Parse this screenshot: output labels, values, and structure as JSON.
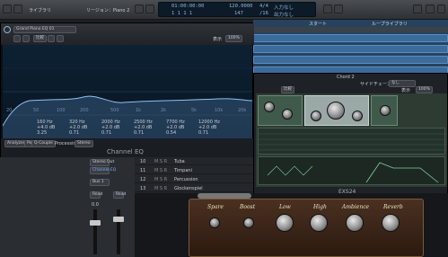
{
  "topbar": {
    "library": "ライブラリ",
    "region": "リージョン：Piano 2",
    "lcd_time": "01:00:00:00",
    "lcd_bars": "1  1  1  1",
    "tempo": "120.0000",
    "tempo_alt": "147",
    "sig": "4/4",
    "sig_alt": "/16",
    "input_none": "入力なし",
    "output_none": "出力なし"
  },
  "right_header": {
    "start": "スタート",
    "loops": "ループライブラリ"
  },
  "eq": {
    "title": "Channel EQ",
    "preset": "Grand Piano EQ 01",
    "compare": "比較",
    "view_label": "表示",
    "view_value": "100%",
    "freq_labels": [
      "20",
      "50",
      "100",
      "200",
      "500",
      "1k",
      "2k",
      "5k",
      "10k",
      "20k"
    ],
    "bands": [
      {
        "freq": "160 Hz",
        "gain": "+4.0 dB",
        "q": "3.25"
      },
      {
        "freq": "320 Hz",
        "gain": "+2.0 dB",
        "q": "0.71"
      },
      {
        "freq": "2000 Hz",
        "gain": "+2.0 dB",
        "q": "0.71"
      },
      {
        "freq": "2500 Hz",
        "gain": "+2.0 dB",
        "q": "0.71"
      },
      {
        "freq": "7700 Hz",
        "gain": "+2.0 dB",
        "q": "0.54"
      },
      {
        "freq": "12000 Hz",
        "gain": "+2.0 dB",
        "q": "0.71"
      }
    ],
    "analyzer": "Analyzer",
    "post": "Post",
    "qcouple": "Q-Couple",
    "processing": "Processing:",
    "processing_value": "Stereo"
  },
  "exs": {
    "title": "EXS24",
    "channel": "Chord 2",
    "sidechain": "サイドチェーン",
    "none": "なし",
    "compare": "比較",
    "view_label": "表示",
    "view_value": "100%"
  },
  "tracks": [
    {
      "num": "10",
      "name": "Tuba"
    },
    {
      "num": "11",
      "name": "Timpani"
    },
    {
      "num": "12",
      "name": "Percussion"
    },
    {
      "num": "13",
      "name": "Glockenspiel"
    }
  ],
  "mixer": {
    "stereo_out": "Stereo Out",
    "channel_eq": "Channel EQ",
    "send": "Bus 1",
    "read1": "Read",
    "read2": "Read",
    "value": "0.0"
  },
  "amp": {
    "labels": [
      "Spare",
      "Boost",
      "Low",
      "High",
      "Ambience",
      "Reverb"
    ]
  }
}
